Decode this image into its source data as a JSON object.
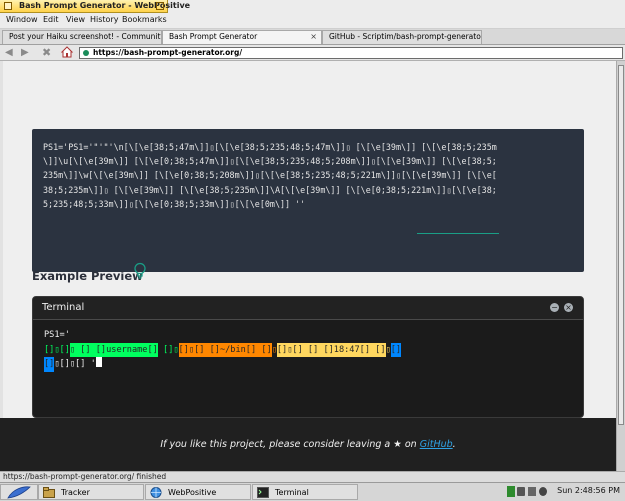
{
  "window": {
    "title": "Bash Prompt Generator - WebPositive"
  },
  "menu": [
    "Window",
    "Edit",
    "View",
    "History",
    "Bookmarks"
  ],
  "tabs": [
    {
      "label": "Post your Haiku screenshot! - Community ..."
    },
    {
      "label": "Bash Prompt Generator"
    },
    {
      "label": "GitHub - Scriptim/bash-prompt-generator..."
    }
  ],
  "address": {
    "url_host": "https://bash-prompt-generator.org/"
  },
  "page": {
    "code": "PS1='PS1='\"'\"'\\n[\\[\\e[38;5;47m\\]]▯[\\[\\e[38;5;235;48;5;47m\\]]▯ [\\[\\e[39m\\]] [\\[\\e[38;5;235m\n\\]]\\u[\\[\\e[39m\\]] [\\[\\e[0;38;5;47m\\]]▯[\\[\\e[38;5;235;48;5;208m\\]]▯[\\[\\e[39m\\]] [\\[\\e[38;5;\n235m\\]]\\w[\\[\\e[39m\\]] [\\[\\e[0;38;5;208m\\]]▯[\\[\\e[38;5;235;48;5;221m\\]]▯[\\[\\e[39m\\]] [\\[\\e[\n38;5;235m\\]]▯ [\\[\\e[39m\\]] [\\[\\e[38;5;235m\\]]\\A[\\[\\e[39m\\]] [\\[\\e[0;38;5;221m\\]]▯[\\[\\e[38;\n5;235;48;5;33m\\]]▯[\\[\\e[0;38;5;33m\\]]▯[\\[\\e[0m\\]] ''",
    "preview_heading": "Example Preview",
    "terminal": {
      "title": "Terminal",
      "line1": "PS1='",
      "seg_open": "[]▯[]",
      "seg_user": "▯ [] []username[]",
      "seg_gap1": " []▯",
      "seg_path": "[]▯[] []~/bin[] []",
      "seg_gap2": "▯",
      "seg_time": "[]▯[] [] []18:47[] []",
      "seg_gap3": "▯",
      "seg_end": "[]",
      "line3_blue": "[]",
      "line3_rest": "▯[]▯[] '"
    },
    "footer": {
      "before": "If you like this project, please consider leaving a",
      "star": "★",
      "on": "on",
      "link": "GitHub",
      "after": "."
    }
  },
  "status": {
    "text": "https://bash-prompt-generator.org/ finished"
  },
  "deskbar": {
    "tracker": "Tracker",
    "webpositive": "WebPositive",
    "terminal": "Terminal",
    "clock": "Sun 2:48:56 PM"
  },
  "colors": {
    "green": "#00ff5f",
    "orange": "#ff8700",
    "yellow": "#ffd75f",
    "blue": "#0087ff",
    "link": "#2fa3e6"
  }
}
